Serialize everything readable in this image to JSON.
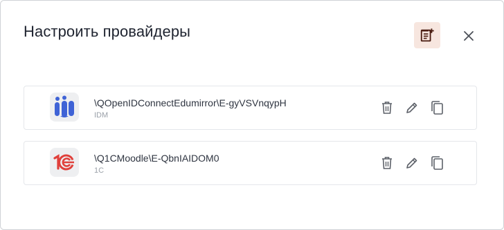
{
  "dialog": {
    "title": "Настроить провайдеры",
    "add_icon": "note-add-icon",
    "close_icon": "close-icon",
    "accent_bg": "#f7e6df",
    "accent_fg": "#4a1d12"
  },
  "providers": [
    {
      "name": "\\QOpenIDConnectEdumirror\\E-gyVSVnqypH",
      "type": "IDM",
      "logo": "idm-logo",
      "logo_color": "#3f63d6"
    },
    {
      "name": "\\Q1CMoodle\\E-QbnIAIDOM0",
      "type": "1C",
      "logo": "1c-logo",
      "logo_color": "#e0403b"
    }
  ],
  "row_actions": [
    "delete-icon",
    "edit-icon",
    "copy-icon"
  ]
}
